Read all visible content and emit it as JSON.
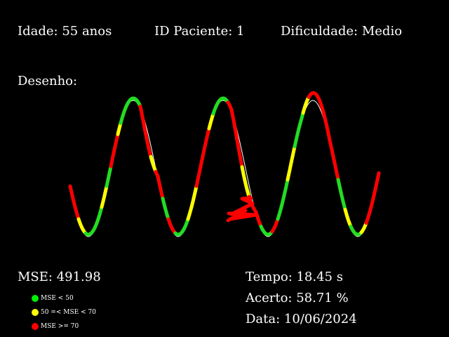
{
  "header": {
    "age_label": "Idade: 55 anos",
    "patient_label": "ID Paciente: 1",
    "difficulty_label": "Dificuldade: Medio"
  },
  "drawing_label": "Desenho:",
  "stats": {
    "mse_label": "MSE: 491.98",
    "time_label": "Tempo: 18.45 s",
    "accuracy_label": "Acerto: 58.71 %",
    "date_label": "Data: 10/06/2024"
  },
  "legend": {
    "items": [
      {
        "label": "MSE < 50",
        "color": "#00ee00"
      },
      {
        "label": "50 =< MSE < 70",
        "color": "#ffff00"
      },
      {
        "label": "MSE >= 70",
        "color": "#ff0000"
      }
    ]
  },
  "colors": {
    "background": "#000000",
    "text": "#ffffff",
    "reference_curve": "#ffffff",
    "good": "#22dd22",
    "medium": "#ffff00",
    "bad": "#ff0000"
  }
}
